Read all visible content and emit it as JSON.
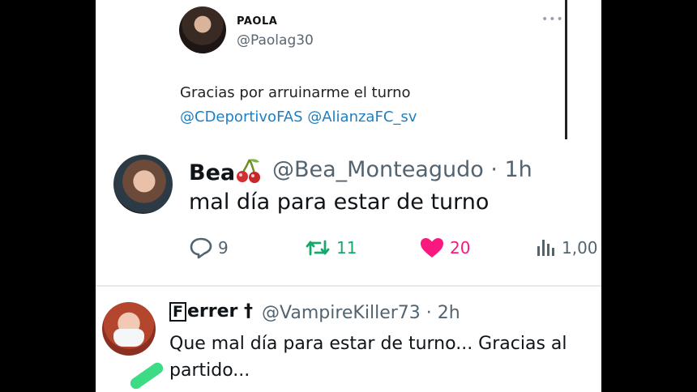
{
  "tweet_quoted": {
    "name": "PAOLA",
    "handle": "@Paolag30",
    "more": "•••",
    "text": "Gracias por arruinarme el turno",
    "mentions": "@CDeportivoFAS @AlianzaFC_sv"
  },
  "tweet_main": {
    "name": "Bea",
    "emoji": "cherries-icon",
    "handle_time": "@Bea_Monteagudo · 1h",
    "text": "mal día para estar de turno",
    "actions": {
      "replies": "9",
      "retweets": "11",
      "likes": "20",
      "views": "1,00"
    },
    "colors": {
      "retweet": "#17a86b",
      "like": "#f91880",
      "muted": "#536471"
    }
  },
  "tweet_reply": {
    "name_boxed_letter": "F",
    "name_rest": "errer †",
    "handle_time": "@VampireKiller73 · 2h",
    "text": "Que mal día para estar de turno... Gracias al partido..."
  }
}
